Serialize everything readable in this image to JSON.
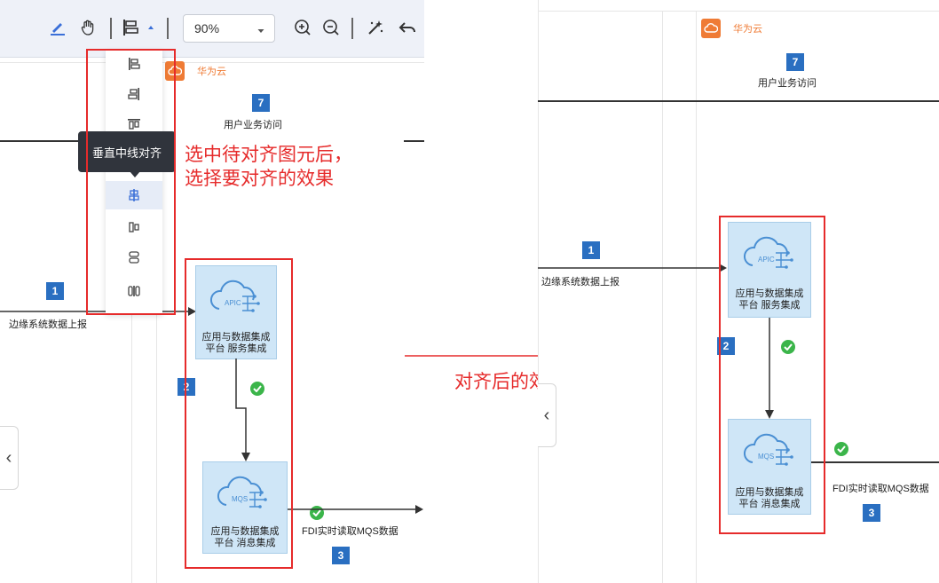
{
  "toolbar": {
    "zoom_value": "90%",
    "icons": [
      "highlight-pen-icon",
      "pan-hand-icon",
      "align-icon",
      "dropdown-caret-icon",
      "zoom-in-icon",
      "zoom-out-icon",
      "magic-wand-icon",
      "undo-icon"
    ]
  },
  "align_menu": {
    "items": [
      "align-left-icon",
      "align-right-icon",
      "align-top-icon",
      "align-vertical-center-icon",
      "align-horizontal-center-icon",
      "align-bottom-icon",
      "distribute-icon"
    ],
    "tooltip": "垂直中线对齐"
  },
  "annotations": {
    "instruction_line1": "选中待对齐图元后，",
    "instruction_line2": "选择要对齐的效果",
    "result_label": "对齐后的效果"
  },
  "diagram": {
    "cloud_name": "华为云",
    "step7_num": "7",
    "step7_label": "用户业务访问",
    "step1_num": "1",
    "step1_label": "边缘系统数据上报",
    "step2_num": "2",
    "step3_num": "3",
    "step3_label": "FDI实时读取MQS数据",
    "step3_label_truncated": "FDI实时读取MQS数据",
    "apic_icon_text": "APIC",
    "apic_line1": "应用与数据集成",
    "apic_line2": "平台 服务集成",
    "mqs_icon_text": "MQS",
    "mqs_line1": "应用与数据集成",
    "mqs_line2": "平台 消息集成"
  },
  "colors": {
    "accent_red": "#e62b2b",
    "badge_blue": "#2a6fc1",
    "huawei_orange": "#ef7b35",
    "node_fill": "#cfe6f7",
    "check_green": "#3bb54a"
  }
}
